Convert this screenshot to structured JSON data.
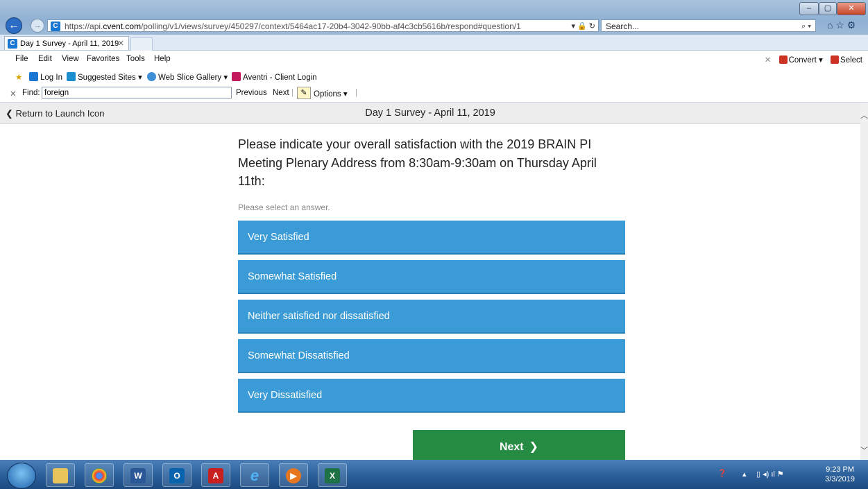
{
  "browser": {
    "url_prefix": "https://api.",
    "url_domain": "cvent.com",
    "url_path": "/polling/v1/views/survey/450297/context/5464ac17-20b4-3042-90bb-af4c3cb5616b/respond#question/1",
    "search_placeholder": "Search...",
    "tab_title": "Day 1 Survey - April 11, 2019",
    "menu": [
      "File",
      "Edit",
      "View",
      "Favorites",
      "Tools",
      "Help"
    ],
    "convert_label": "Convert",
    "select_label": "Select",
    "favorites": {
      "login": "Log In",
      "suggested": "Suggested Sites",
      "webslice": "Web Slice Gallery",
      "aventri": "Aventri - Client Login"
    },
    "find": {
      "label": "Find:",
      "value": "foreign",
      "previous": "Previous",
      "next": "Next",
      "options": "Options"
    }
  },
  "page": {
    "back_link": "Return to Launch Icon",
    "title": "Day 1 Survey - April 11, 2019",
    "question": "Please indicate your overall satisfaction with the 2019 BRAIN PI Meeting Plenary Address from 8:30am-9:30am on Thursday April 11th:",
    "hint": "Please select an answer.",
    "answers": [
      "Very Satisfied",
      "Somewhat Satisfied",
      "Neither satisfied nor dissatisfied",
      "Somewhat Dissatisfied",
      "Very Dissatisfied"
    ],
    "next_label": "Next"
  },
  "taskbar": {
    "time": "9:23 PM",
    "date": "3/3/2019"
  },
  "colors": {
    "answer_blue": "#3a9bd6",
    "next_green": "#268c44"
  }
}
